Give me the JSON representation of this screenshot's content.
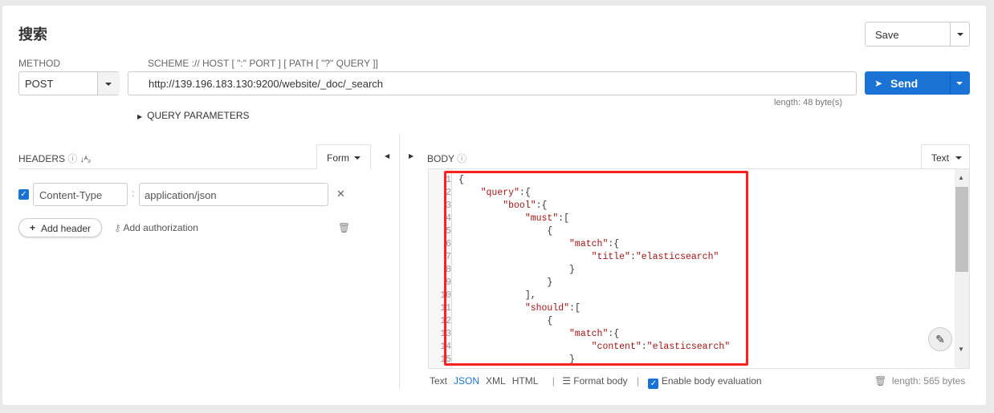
{
  "title": "搜索",
  "save": {
    "label": "Save"
  },
  "method": {
    "label": "METHOD",
    "value": "POST"
  },
  "url": {
    "label": "SCHEME :// HOST [ \":\" PORT ] [ PATH [ \"?\" QUERY ]]",
    "value": "http://139.196.183.130:9200/website/_doc/_search",
    "length": "length: 48 byte(s)"
  },
  "send": {
    "label": "Send"
  },
  "query_params": "QUERY PARAMETERS",
  "headers": {
    "label": "HEADERS",
    "mode": "Form",
    "rows": [
      {
        "enabled": true,
        "key": "Content-Type",
        "value": "application/json"
      }
    ],
    "add_header": "Add header",
    "add_auth": "Add authorization"
  },
  "body": {
    "label": "BODY",
    "mode": "Text",
    "lines": [
      {
        "n": "1",
        "i": 0,
        "p": [
          [
            "{",
            ""
          ]
        ]
      },
      {
        "n": "2",
        "i": 4,
        "p": [
          [
            "\"query\"",
            "k"
          ],
          [
            ":{",
            ""
          ]
        ]
      },
      {
        "n": "3",
        "i": 8,
        "p": [
          [
            "\"bool\"",
            "k"
          ],
          [
            ":{",
            ""
          ]
        ]
      },
      {
        "n": "4",
        "i": 12,
        "p": [
          [
            "\"must\"",
            "k"
          ],
          [
            ":[",
            ""
          ]
        ]
      },
      {
        "n": "5",
        "i": 16,
        "p": [
          [
            "{",
            ""
          ]
        ]
      },
      {
        "n": "6",
        "i": 20,
        "p": [
          [
            "\"match\"",
            "k"
          ],
          [
            ":{",
            ""
          ]
        ]
      },
      {
        "n": "7",
        "i": 24,
        "p": [
          [
            "\"title\"",
            "k"
          ],
          [
            ":",
            ""
          ],
          [
            "\"elasticsearch\"",
            "k"
          ]
        ]
      },
      {
        "n": "8",
        "i": 20,
        "p": [
          [
            "}",
            ""
          ]
        ]
      },
      {
        "n": "9",
        "i": 16,
        "p": [
          [
            "}",
            ""
          ]
        ]
      },
      {
        "n": "10",
        "i": 12,
        "p": [
          [
            "],",
            ""
          ]
        ]
      },
      {
        "n": "11",
        "i": 12,
        "p": [
          [
            "\"should\"",
            "k"
          ],
          [
            ":[",
            ""
          ]
        ]
      },
      {
        "n": "12",
        "i": 16,
        "p": [
          [
            "{",
            ""
          ]
        ]
      },
      {
        "n": "13",
        "i": 20,
        "p": [
          [
            "\"match\"",
            "k"
          ],
          [
            ":{",
            ""
          ]
        ]
      },
      {
        "n": "14",
        "i": 24,
        "p": [
          [
            "\"content\"",
            "k"
          ],
          [
            ":",
            ""
          ],
          [
            "\"elasticsearch\"",
            "k"
          ]
        ]
      },
      {
        "n": "15",
        "i": 20,
        "p": [
          [
            "}",
            ""
          ]
        ]
      }
    ],
    "formats": [
      "Text",
      "JSON",
      "XML",
      "HTML"
    ],
    "active_format": "JSON",
    "format_body": "Format body",
    "enable_eval": "Enable body evaluation",
    "length": "length: 565 bytes"
  },
  "colors": {
    "accent": "#1a73d4",
    "highlight": "#ff2020",
    "key": "#a31515"
  }
}
